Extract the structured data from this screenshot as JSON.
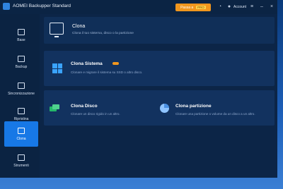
{
  "app": {
    "title": "AOMEI Backupper Standard",
    "upgrade_label": "Passa a",
    "upgrade_tag": "PRO",
    "account_label": "Account"
  },
  "sidebar": {
    "items": [
      {
        "label": "Base",
        "icon": "plus-icon",
        "active": false
      },
      {
        "label": "Backup",
        "icon": "backup-icon",
        "active": false
      },
      {
        "label": "Sincronizzazione",
        "icon": "sync-icon",
        "active": false
      },
      {
        "label": "Ripristina",
        "icon": "restore-icon",
        "active": false
      },
      {
        "label": "Clona",
        "icon": "clone-icon",
        "active": true
      },
      {
        "label": "Strumenti",
        "icon": "tools-icon",
        "active": false
      }
    ]
  },
  "header": {
    "title": "Clona",
    "subtitle": "Clona il tuo sistema, disco o la partizione"
  },
  "cards": {
    "system": {
      "title": "Clona Sistema",
      "desc": "Clonare e migrare il sistema su SSD o altro disco."
    },
    "disk": {
      "title": "Clona Disco",
      "desc": "Clonare un disco rigido in un altro."
    },
    "partition": {
      "title": "Clona partizione",
      "desc": "Clonare una partizione o volume da un disco a un altro."
    }
  },
  "colors": {
    "accent": "#1778e6",
    "upgrade": "#f0961e",
    "panel": "#12325f"
  }
}
